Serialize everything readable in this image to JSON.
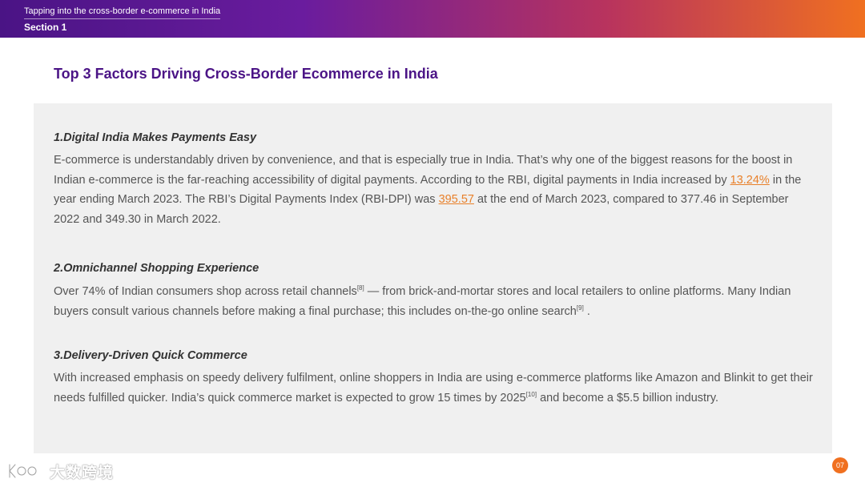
{
  "header": {
    "subtitle": "Tapping into the cross-border e-commerce in India",
    "section": "Section 1"
  },
  "page_title": "Top 3 Factors Driving Cross-Border Ecommerce in India",
  "factors": [
    {
      "heading": "1.Digital India Makes Payments Easy",
      "p1": "E-commerce is understandably driven by convenience, and that is especially true in India. That’s why one of the biggest reasons for the boost in Indian e-commerce is the far-reaching accessibility of digital payments. According to the RBI, digital payments in India increased by ",
      "link1": "13.24%",
      "p2": " in the year ending March 2023. The RBI’s Digital Payments Index (RBI-DPI) was ",
      "link2": "395.57",
      "p3": " at the end of March 2023, compared to 377.46 in September 2022 and 349.30 in March 2022."
    },
    {
      "heading": "2.Omnichannel Shopping Experience",
      "p1": "Over 74% of Indian consumers shop across retail channels",
      "ref1": "[8]",
      "p2": " — from brick-and-mortar stores and local retailers to online platforms. Many Indian buyers consult various channels before making a final purchase; this includes on-the-go online search",
      "ref2": "[9]",
      "p3": " ."
    },
    {
      "heading": "3.Delivery-Driven Quick Commerce",
      "p1": "With increased emphasis on speedy delivery fulfilment, online shoppers in India are using e-commerce platforms like Amazon and Blinkit to get their needs fulfilled quicker. India’s quick commerce market is expected to grow 15 times by 2025",
      "ref1": "[10]",
      "p2": " and become a $5.5 billion industry."
    }
  ],
  "watermark": {
    "text": "大数跨境",
    "icon": "brand-logo-icon"
  },
  "page_number": "07",
  "colors": {
    "title_purple": "#4b1486",
    "link_orange": "#e8802a",
    "panel_gray": "#f0f0f0",
    "badge_orange": "#f07020"
  }
}
